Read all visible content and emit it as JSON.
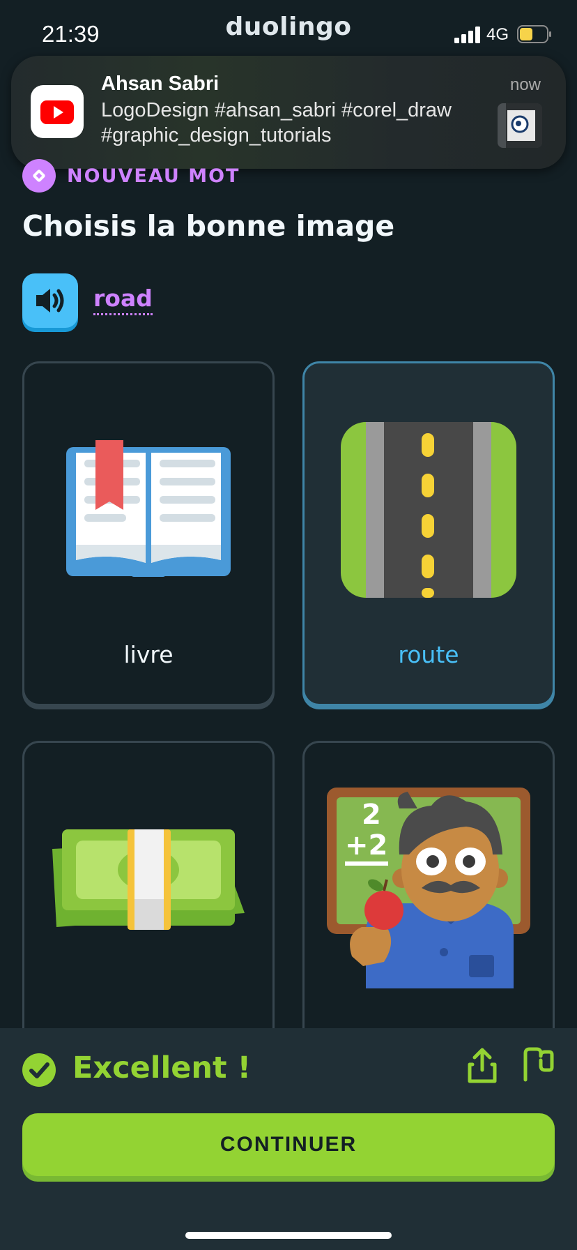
{
  "status_bar": {
    "time": "21:39",
    "app_name": "duolingo",
    "network": "4G"
  },
  "notification": {
    "app_icon": "youtube-icon",
    "sender": "Ahsan Sabri",
    "body_line1": "LogoDesign #ahsan_sabri #corel_draw",
    "body_line2": "#graphic_design_tutorials",
    "time": "now"
  },
  "lesson": {
    "badge": "NOUVEAU MOT",
    "title": "Choisis la bonne image",
    "word": "road",
    "speaker_icon": "speaker-icon"
  },
  "choices": [
    {
      "label": "livre",
      "icon": "book-icon",
      "selected": false
    },
    {
      "label": "route",
      "icon": "road-icon",
      "selected": true
    },
    {
      "label": "",
      "icon": "money-icon",
      "selected": false
    },
    {
      "label": "",
      "icon": "teacher-icon",
      "selected": false
    }
  ],
  "feedback": {
    "message": "Excellent !",
    "continue_label": "CONTINUER"
  },
  "colors": {
    "background": "#131f24",
    "accent_purple": "#ce82ff",
    "accent_blue": "#49c0f8",
    "accent_green": "#93d333"
  }
}
